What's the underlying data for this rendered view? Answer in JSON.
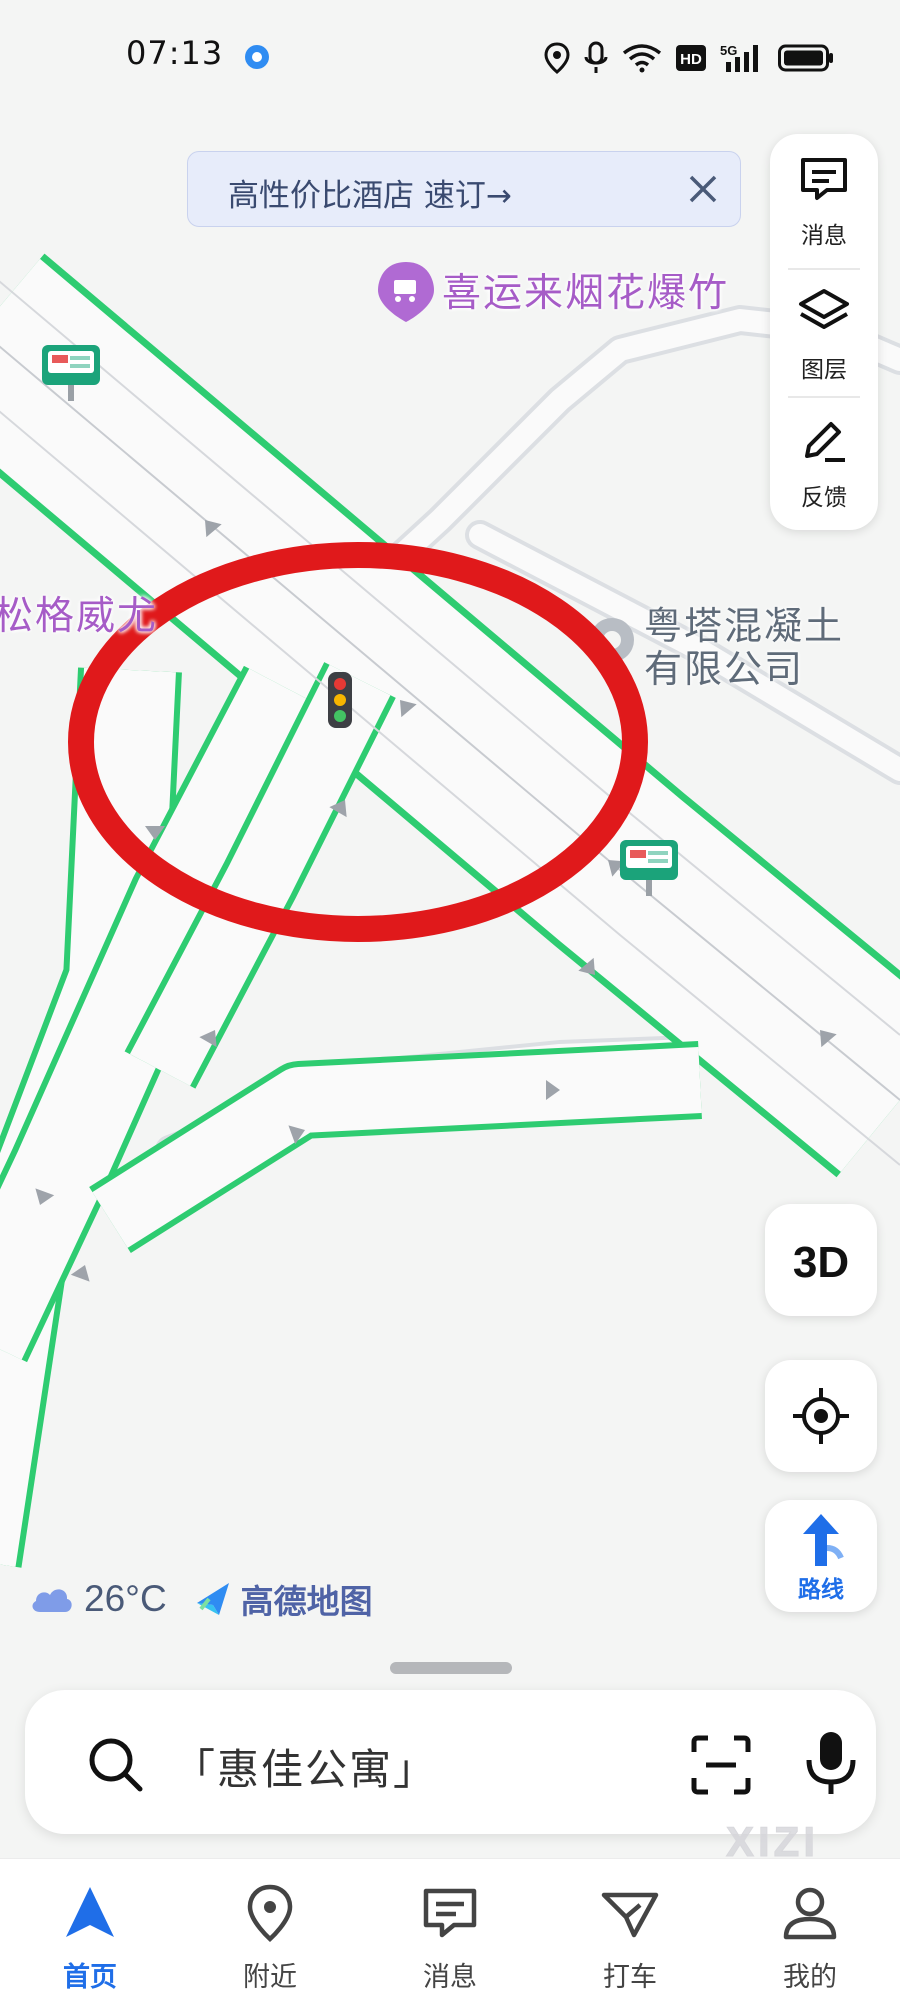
{
  "status_bar": {
    "time": "07:13",
    "icons": [
      "location-icon",
      "mic-icon",
      "wifi-icon",
      "hd-icon",
      "5g-signal-icon",
      "battery-icon"
    ],
    "hd_label": "HD",
    "network_label": "5G"
  },
  "promo_banner": {
    "text": "高性价比酒店 速订→"
  },
  "side_panel": [
    {
      "label": "消息",
      "icon": "message-icon"
    },
    {
      "label": "图层",
      "icon": "layers-icon"
    },
    {
      "label": "反馈",
      "icon": "feedback-pen-icon"
    }
  ],
  "map": {
    "poi_labels": {
      "fireworks": "喜运来烟花爆竹",
      "partial_left": "松格威尤",
      "concrete_line1": "粤塔混凝土",
      "concrete_line2": "有限公司"
    },
    "highlight_color": "#e0191b",
    "road_edge_color": "#2ecc71"
  },
  "map_controls": {
    "three_d_label": "3D",
    "locate_icon": "locate-target-icon",
    "route_label": "路线"
  },
  "weather": {
    "temperature": "26°C",
    "icon": "cloud-icon"
  },
  "brand": {
    "name": "高德地图"
  },
  "search": {
    "text": "「惠佳公寓」"
  },
  "watermark": "XIZI",
  "tabs": [
    {
      "label": "首页",
      "icon": "navigation-arrow-icon",
      "active": true
    },
    {
      "label": "附近",
      "icon": "location-pin-icon",
      "active": false
    },
    {
      "label": "消息",
      "icon": "message-icon",
      "active": false
    },
    {
      "label": "打车",
      "icon": "taxi-icon",
      "active": false
    },
    {
      "label": "我的",
      "icon": "user-icon",
      "active": false
    }
  ],
  "colors": {
    "accent": "#1f6ee8",
    "poi_purple": "#a65cc7"
  }
}
